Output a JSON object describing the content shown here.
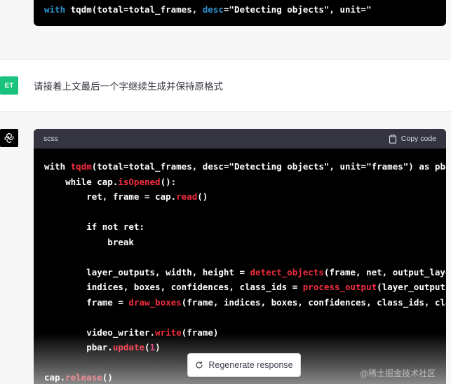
{
  "previous_message": {
    "code_line": {
      "kw": "with",
      "rest": " tqdm(total=total_frames, ",
      "param": "desc",
      "tail": "=\"Detecting objects\", unit=\""
    }
  },
  "user_message": {
    "avatar": "ET",
    "text": "请接着上文最后一个字继续生成并保持原格式"
  },
  "assistant_message": {
    "avatar_icon": "openai-logo-icon",
    "code_block": {
      "language": "scss",
      "copy_label": "Copy code",
      "lines": [
        [
          {
            "t": "with ",
            "c": "kw"
          },
          {
            "t": "tqdm",
            "c": "fn"
          },
          {
            "t": "(total=total_frames, desc=\"Detecting objects\", unit=\"frames\") as pbar:",
            "c": "kw"
          }
        ],
        [
          {
            "t": "    while cap.",
            "c": "kw"
          },
          {
            "t": "isOpened",
            "c": "fn"
          },
          {
            "t": "():",
            "c": "kw"
          }
        ],
        [
          {
            "t": "        ret, frame = cap.",
            "c": "kw"
          },
          {
            "t": "read",
            "c": "fn"
          },
          {
            "t": "()",
            "c": "kw"
          }
        ],
        [],
        [
          {
            "t": "        if not ret:",
            "c": "kw"
          }
        ],
        [
          {
            "t": "            break",
            "c": "kw"
          }
        ],
        [],
        [
          {
            "t": "        layer_outputs, width, height = ",
            "c": "kw"
          },
          {
            "t": "detect_objects",
            "c": "fn"
          },
          {
            "t": "(frame, net, output_layers)",
            "c": "kw"
          }
        ],
        [
          {
            "t": "        indices, boxes, confidences, class_ids = ",
            "c": "kw"
          },
          {
            "t": "process_output",
            "c": "fn"
          },
          {
            "t": "(layer_outputs, width, height)",
            "c": "kw"
          }
        ],
        [
          {
            "t": "        frame = ",
            "c": "kw"
          },
          {
            "t": "draw_boxes",
            "c": "fn"
          },
          {
            "t": "(frame, indices, boxes, confidences, class_ids, classes)",
            "c": "kw"
          }
        ],
        [],
        [
          {
            "t": "        video_writer.",
            "c": "kw"
          },
          {
            "t": "write",
            "c": "fn"
          },
          {
            "t": "(frame)",
            "c": "kw"
          }
        ],
        [
          {
            "t": "        pbar.",
            "c": "kw"
          },
          {
            "t": "update",
            "c": "fn"
          },
          {
            "t": "(",
            "c": "kw"
          },
          {
            "t": "1",
            "c": "num"
          },
          {
            "t": ")",
            "c": "kw"
          }
        ],
        [],
        [
          {
            "t": "cap.",
            "c": "kw"
          },
          {
            "t": "release",
            "c": "fn"
          },
          {
            "t": "()",
            "c": "kw"
          }
        ]
      ]
    }
  },
  "regenerate_button": {
    "label": "Regenerate response",
    "icon": "refresh-icon"
  },
  "watermark": "@稀土掘金技术社区"
}
